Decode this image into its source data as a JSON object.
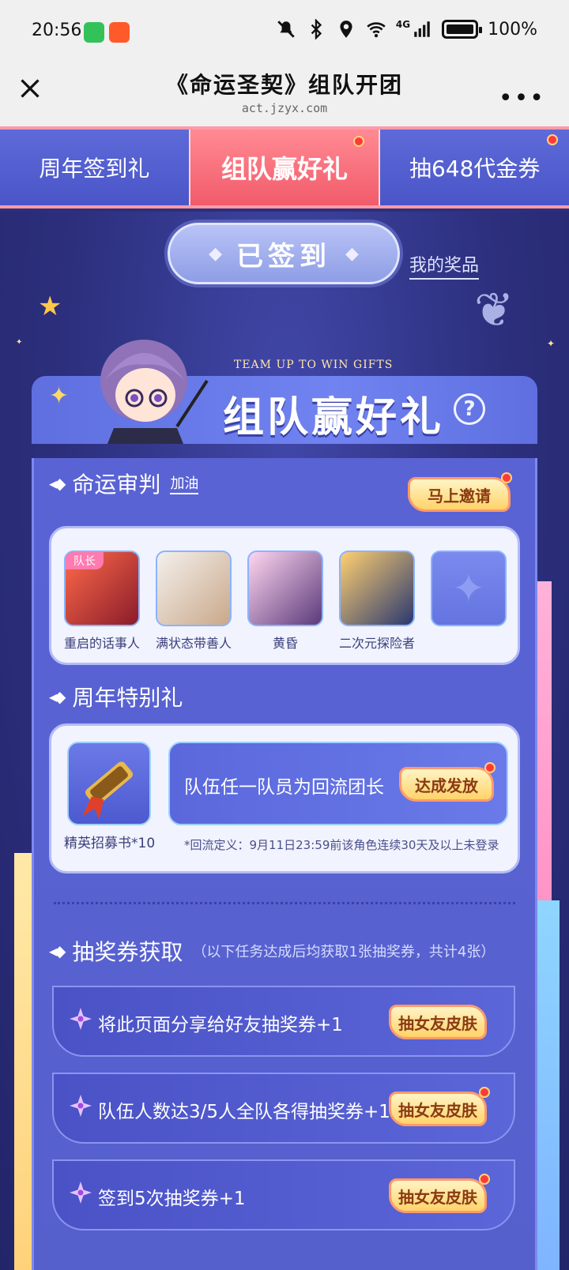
{
  "status_bar": {
    "time": "20:56",
    "network": "4G",
    "battery": "100%",
    "icons": [
      "wechat-app-icon",
      "taobao-app-icon",
      "mute-icon",
      "bluetooth-icon",
      "location-icon",
      "wifi-icon",
      "signal-icon",
      "battery-icon"
    ]
  },
  "browser": {
    "title": "《命运圣契》组队开团",
    "url": "act.jzyx.com"
  },
  "tabs": [
    {
      "label": "周年签到礼",
      "active": false
    },
    {
      "label": "组队赢好礼",
      "active": true
    },
    {
      "label": "抽648代金券",
      "active": false
    }
  ],
  "signin": {
    "button_label": "已签到",
    "my_prizes": "我的奖品"
  },
  "banner": {
    "english": "TEAM UP TO WIN GIFTS",
    "title": "组队赢好礼",
    "help": "?"
  },
  "team": {
    "name": "命运审判",
    "cheer": "加油",
    "invite_label": "马上邀请",
    "leader_tag": "队长",
    "members": [
      {
        "name": "重启的话事人"
      },
      {
        "name": "满状态带善人"
      },
      {
        "name": "黄昏"
      },
      {
        "name": "二次元探险者"
      },
      {
        "name": ""
      }
    ]
  },
  "anniversary": {
    "title": "周年特别礼",
    "item_name": "精英招募书*10",
    "condition": "队伍任一队员为回流团长",
    "button": "达成发放",
    "note": "*回流定义：9月11日23:59前该角色连续30天及以上未登录"
  },
  "lottery": {
    "title": "抽奖券获取",
    "subtitle": "（以下任务达成后均获取1张抽奖券，共计4张）",
    "tasks": [
      {
        "text": "将此页面分享给好友抽奖券+1",
        "button": "抽女友皮肤"
      },
      {
        "text": "队伍人数达3/5人全队各得抽奖券+1",
        "button": "抽女友皮肤"
      },
      {
        "text": "签到5次抽奖券+1",
        "button": "抽女友皮肤"
      }
    ]
  },
  "colors": {
    "tab_active": "#f25b6a",
    "panel": "#5a63d4",
    "gold_button": "#ffd36a",
    "notification_dot": "#ff3a3a"
  }
}
